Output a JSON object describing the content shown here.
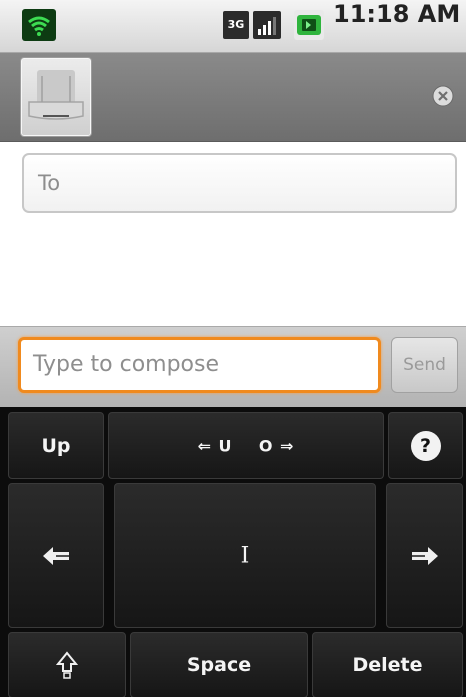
{
  "status_bar": {
    "time": "11:18 AM",
    "network_type": "3G",
    "icons": [
      "wifi-icon",
      "signal-icon",
      "battery-icon"
    ]
  },
  "header": {
    "avatar_icon": "contact-avatar-icon",
    "close_icon": "close-circle-icon"
  },
  "recipients": {
    "to_placeholder": "To"
  },
  "compose": {
    "placeholder": "Type to compose",
    "send_label": "Send",
    "accent_color": "#f08a1e"
  },
  "keypad": {
    "up_label": "Up",
    "uo_label": "⇐ U    O ⇒",
    "help_label": "?",
    "cursor_label": "I",
    "space_label": "Space",
    "delete_label": "Delete",
    "left_icon": "arrow-left-icon",
    "right_icon": "arrow-right-icon",
    "shift_icon": "shift-icon"
  }
}
